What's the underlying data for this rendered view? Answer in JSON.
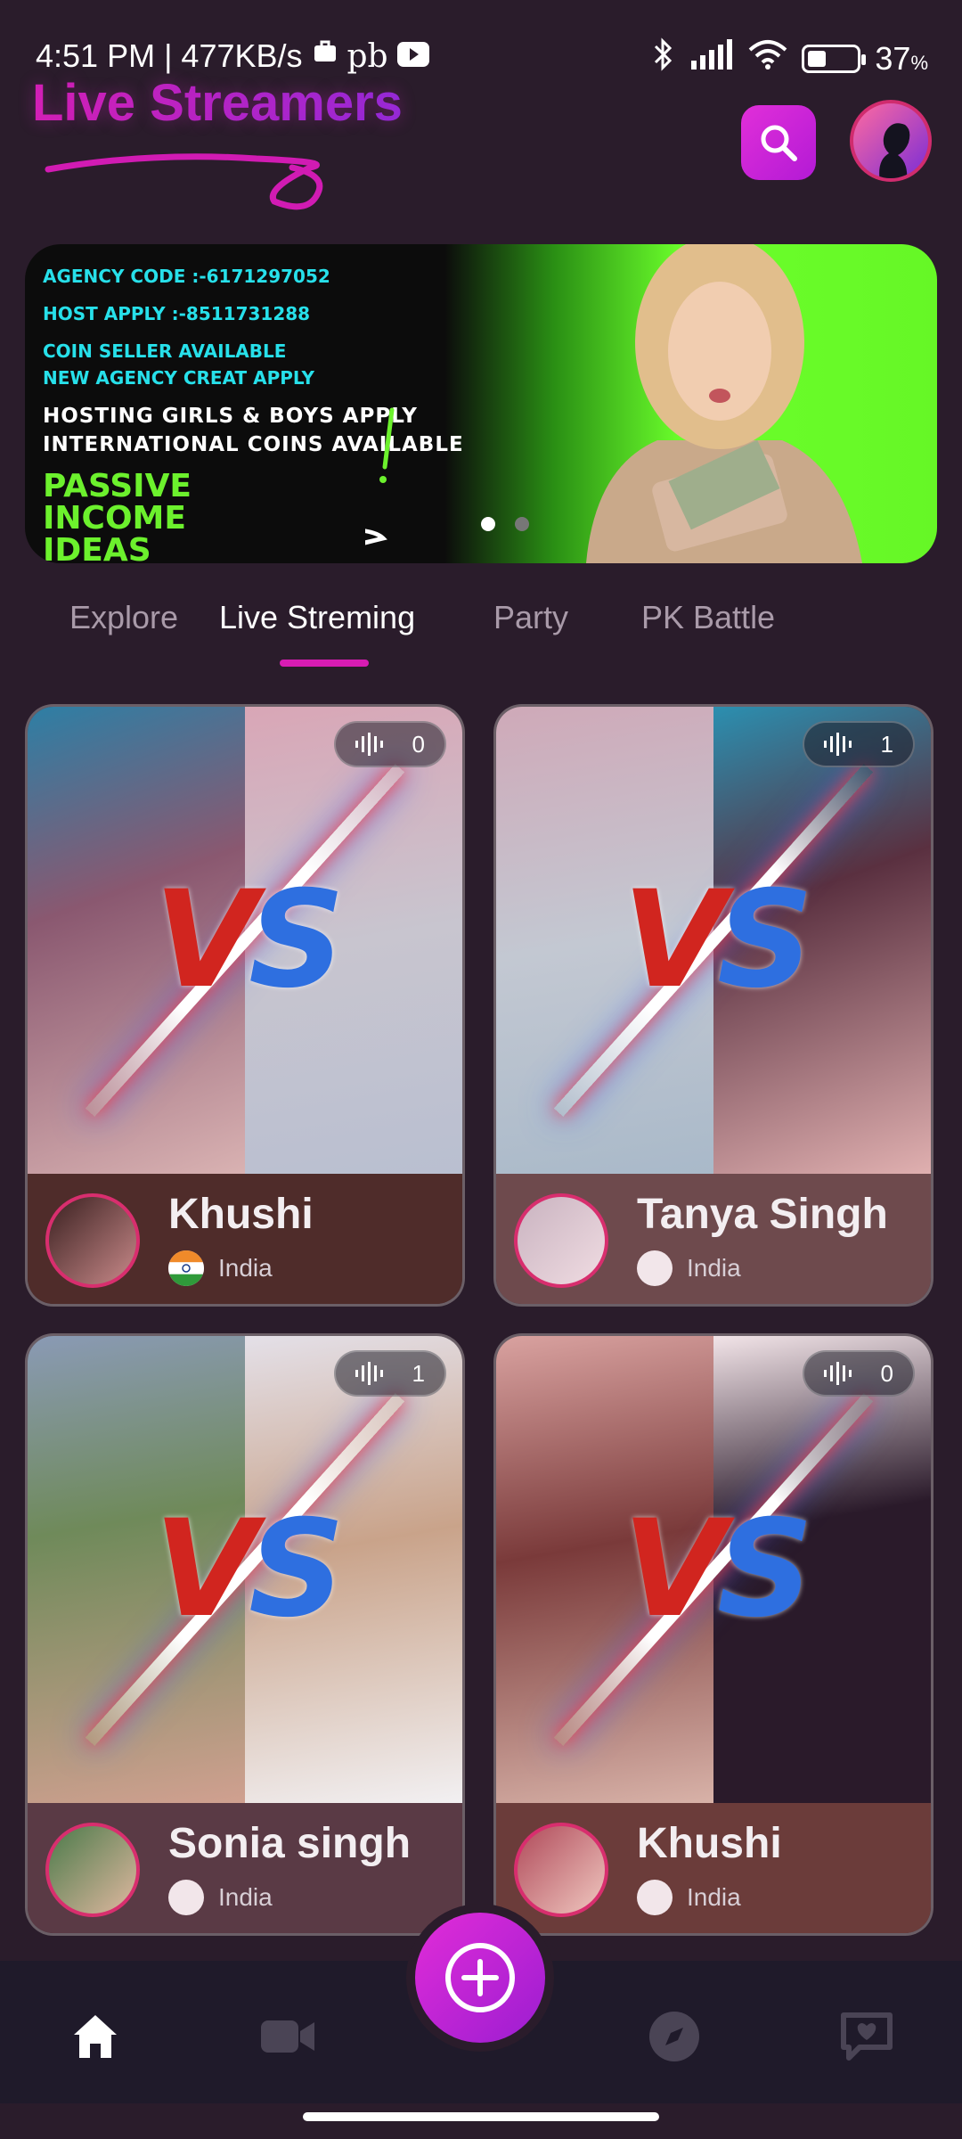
{
  "status": {
    "time_speed": "4:51 PM | 477KB/s",
    "extra": "pb",
    "battery": "37",
    "battery_unit": "%"
  },
  "header": {
    "title": "Live Streamers"
  },
  "banner": {
    "lines": [
      "AGENCY CODE :-6171297052",
      "HOST APPLY :-8511731288",
      "COIN SELLER AVAILABLE",
      "NEW AGENCY CREAT APPLY",
      "HOSTING GIRLS & BOYS APPLY",
      "INTERNATIONAL COINS AVAILABLE",
      "PASSIVE",
      "INCOME",
      "IDEAS"
    ]
  },
  "tabs": [
    "Explore",
    "Live Streming",
    "Party",
    "PK Battle"
  ],
  "cards": [
    {
      "name": "Khushi",
      "country": "India",
      "viewers": "0"
    },
    {
      "name": "Tanya Singh",
      "country": "India",
      "viewers": "1"
    },
    {
      "name": "Sonia singh",
      "country": "India",
      "viewers": "1"
    },
    {
      "name": "Khushi",
      "country": "India",
      "viewers": "0"
    }
  ],
  "vs": {
    "v": "V",
    "s": "S"
  },
  "colors": {
    "accent": "#d81cb3",
    "background": "#2a1c2b",
    "nav": "#1f1a2a"
  },
  "icons": {
    "nav": [
      "home-icon",
      "video-icon",
      "add-icon",
      "compass-icon",
      "chat-icon"
    ]
  }
}
